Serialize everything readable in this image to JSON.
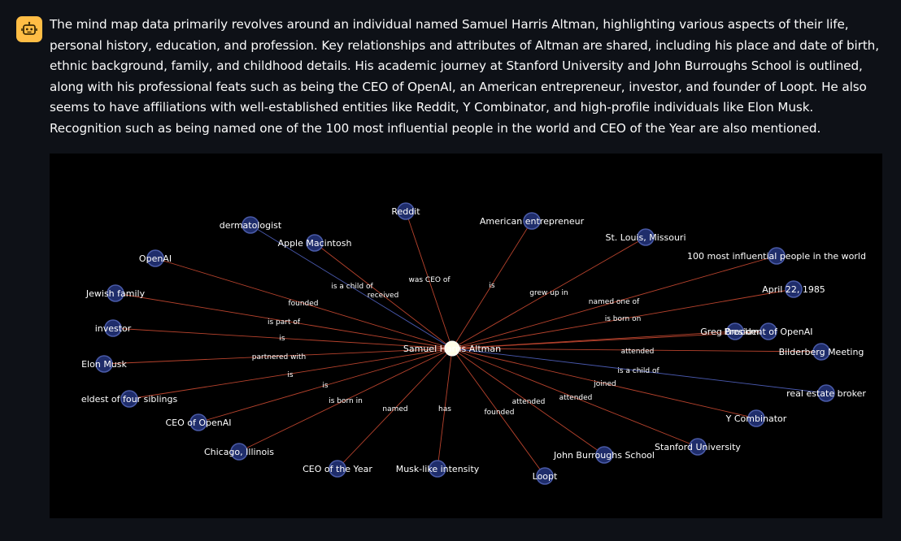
{
  "assistant": {
    "avatar_icon": "robot-icon",
    "avatar_color": "#ffbd45",
    "message": "The mind map data primarily revolves around an individual named Samuel Harris Altman, highlighting various aspects of their life, personal history, education, and profession. Key relationships and attributes of Altman are shared, including his place and date of birth, ethnic background, family, and childhood details. His academic journey at Stanford University and John Burroughs School is outlined, along with his professional feats such as being the CEO of OpenAI, an American entrepreneur, investor, and founder of Loopt. He also seems to have affiliations with well-established entities like Reddit, Y Combinator, and high-profile individuals like Elon Musk. Recognition such as being named one of the 100 most influential people in the world and CEO of the Year are also mentioned."
  },
  "graph": {
    "colors": {
      "background": "#000000",
      "node_fill": "#1f2d6b",
      "node_stroke": "#4a5ba8",
      "center_fill": "#fffde8",
      "edge_red": "#b8432d",
      "edge_blue": "#4a5ab0"
    },
    "center": {
      "label": "Samuel Harris Altman"
    },
    "nodes": [
      {
        "id": "reddit",
        "label": "Reddit"
      },
      {
        "id": "american-entrepreneur",
        "label": "American entrepreneur"
      },
      {
        "id": "dermatologist",
        "label": "dermatologist"
      },
      {
        "id": "apple-macintosh",
        "label": "Apple Macintosh"
      },
      {
        "id": "st-louis",
        "label": "St. Louis, Missouri"
      },
      {
        "id": "openai",
        "label": "OpenAI"
      },
      {
        "id": "100-most-influential",
        "label": "100 most influential people in the world"
      },
      {
        "id": "jewish-family",
        "label": "Jewish family"
      },
      {
        "id": "april-22",
        "label": "April 22, 1985"
      },
      {
        "id": "investor",
        "label": "investor"
      },
      {
        "id": "greg-brockman",
        "label": "Greg Brockman"
      },
      {
        "id": "president-openai",
        "label": "President of OpenAI"
      },
      {
        "id": "bilderberg",
        "label": "Bilderberg Meeting"
      },
      {
        "id": "elon-musk",
        "label": "Elon Musk"
      },
      {
        "id": "real-estate-broker",
        "label": "real estate broker"
      },
      {
        "id": "eldest",
        "label": "eldest of four siblings"
      },
      {
        "id": "y-combinator",
        "label": "Y Combinator"
      },
      {
        "id": "ceo-openai",
        "label": "CEO of OpenAI"
      },
      {
        "id": "stanford",
        "label": "Stanford University"
      },
      {
        "id": "chicago",
        "label": "Chicago, Illinois"
      },
      {
        "id": "john-burroughs",
        "label": "John Burroughs School"
      },
      {
        "id": "ceo-of-year",
        "label": "CEO of the Year"
      },
      {
        "id": "musk-like",
        "label": "Musk-like intensity"
      },
      {
        "id": "loopt",
        "label": "Loopt"
      }
    ],
    "edges": [
      {
        "target": "reddit",
        "label": "was CEO of",
        "color": "red"
      },
      {
        "target": "american-entrepreneur",
        "label": "is",
        "color": "red"
      },
      {
        "target": "dermatologist",
        "label": "is a child of",
        "color": "blue"
      },
      {
        "target": "apple-macintosh",
        "label": "received",
        "color": "red"
      },
      {
        "target": "st-louis",
        "label": "grew up in",
        "color": "red"
      },
      {
        "target": "openai",
        "label": "founded",
        "color": "red"
      },
      {
        "target": "100-most-influential",
        "label": "named one of",
        "color": "red"
      },
      {
        "target": "jewish-family",
        "label": "is part of",
        "color": "red"
      },
      {
        "target": "april-22",
        "label": "is born on",
        "color": "red"
      },
      {
        "target": "investor",
        "label": "is",
        "color": "red"
      },
      {
        "target": "greg-brockman",
        "label": "",
        "color": "red"
      },
      {
        "target": "president-openai",
        "label": "",
        "color": "red"
      },
      {
        "target": "bilderberg",
        "label": "attended",
        "color": "red"
      },
      {
        "target": "elon-musk",
        "label": "partnered with",
        "color": "red"
      },
      {
        "target": "real-estate-broker",
        "label": "is a child of",
        "color": "blue"
      },
      {
        "target": "eldest",
        "label": "is",
        "color": "red"
      },
      {
        "target": "y-combinator",
        "label": "joined",
        "color": "red"
      },
      {
        "target": "ceo-openai",
        "label": "is",
        "color": "red"
      },
      {
        "target": "stanford",
        "label": "attended",
        "color": "red"
      },
      {
        "target": "chicago",
        "label": "is born in",
        "color": "red"
      },
      {
        "target": "john-burroughs",
        "label": "attended",
        "color": "red"
      },
      {
        "target": "ceo-of-year",
        "label": "named",
        "color": "red"
      },
      {
        "target": "musk-like",
        "label": "has",
        "color": "red"
      },
      {
        "target": "loopt",
        "label": "founded",
        "color": "red"
      }
    ]
  }
}
